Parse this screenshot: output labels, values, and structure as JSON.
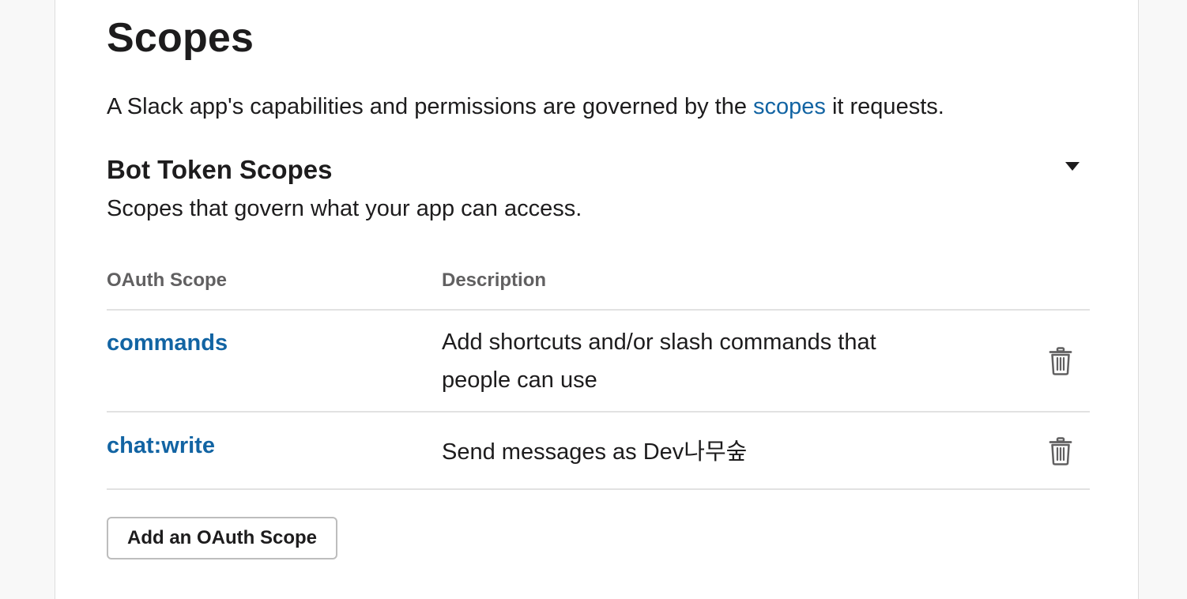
{
  "page": {
    "title": "Scopes",
    "intro": {
      "before_link": "A Slack app's capabilities and permissions are governed by the ",
      "link_text": "scopes",
      "after_link": " it requests."
    }
  },
  "bot_token_scopes": {
    "title": "Bot Token Scopes",
    "description": "Scopes that govern what your app can access.",
    "toggle_icon": "caret-down-icon",
    "columns": {
      "scope": "OAuth Scope",
      "description": "Description"
    },
    "rows": [
      {
        "scope": "commands",
        "description": "Add shortcuts and/or slash commands that people can use",
        "action_icon": "trash-icon"
      },
      {
        "scope": "chat:write",
        "description": "Send messages as Dev나무숲",
        "action_icon": "trash-icon"
      }
    ],
    "add_button_label": "Add an OAuth Scope"
  },
  "colors": {
    "link": "#1264a3",
    "text": "#1d1c1d",
    "muted": "#616061",
    "divider": "#e2e2e2",
    "background": "#f8f8f8"
  }
}
